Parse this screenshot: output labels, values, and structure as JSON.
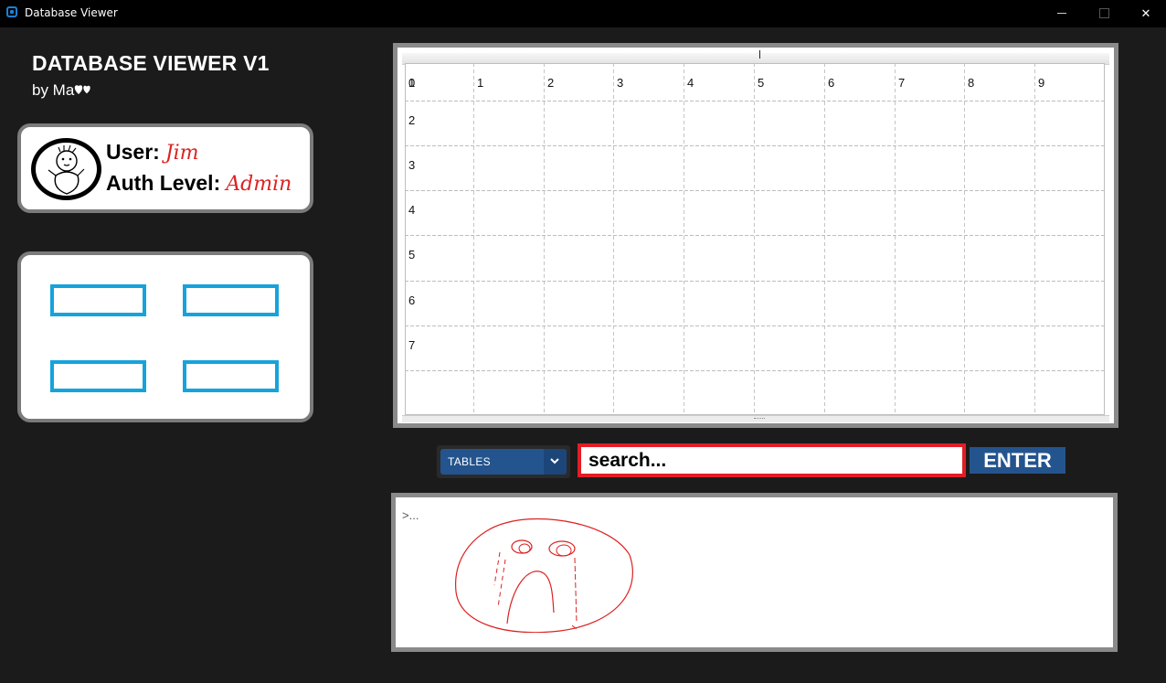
{
  "window": {
    "title": "Database Viewer",
    "icon": "app-window-icon",
    "controls": [
      "minimize",
      "maximize",
      "close"
    ]
  },
  "header": {
    "title": "DATABASE VIEWER V1",
    "subtitle": "by Ma",
    "subtitle_icon": "hearts-icon"
  },
  "user": {
    "user_label": "User:",
    "user_value": "Jim",
    "auth_label": "Auth Level:",
    "auth_value": "Admin"
  },
  "actions": {
    "buttons": [
      "",
      "",
      "",
      ""
    ]
  },
  "grid": {
    "column_headers": [
      "0",
      "1",
      "2",
      "3",
      "4",
      "5",
      "6",
      "7",
      "8",
      "9"
    ],
    "row_headers": [
      "1",
      "2",
      "3",
      "4",
      "5",
      "6",
      "7"
    ]
  },
  "controls": {
    "table_select": "TABLES",
    "search_placeholder": "search...",
    "enter_label": "ENTER"
  },
  "console": {
    "prompt": ">..."
  },
  "colors": {
    "background": "#1b1b1b",
    "accent_blue": "#24548e",
    "button_outline": "#15a3dc",
    "search_border": "#e21d26",
    "handwriting": "#dd2222"
  }
}
